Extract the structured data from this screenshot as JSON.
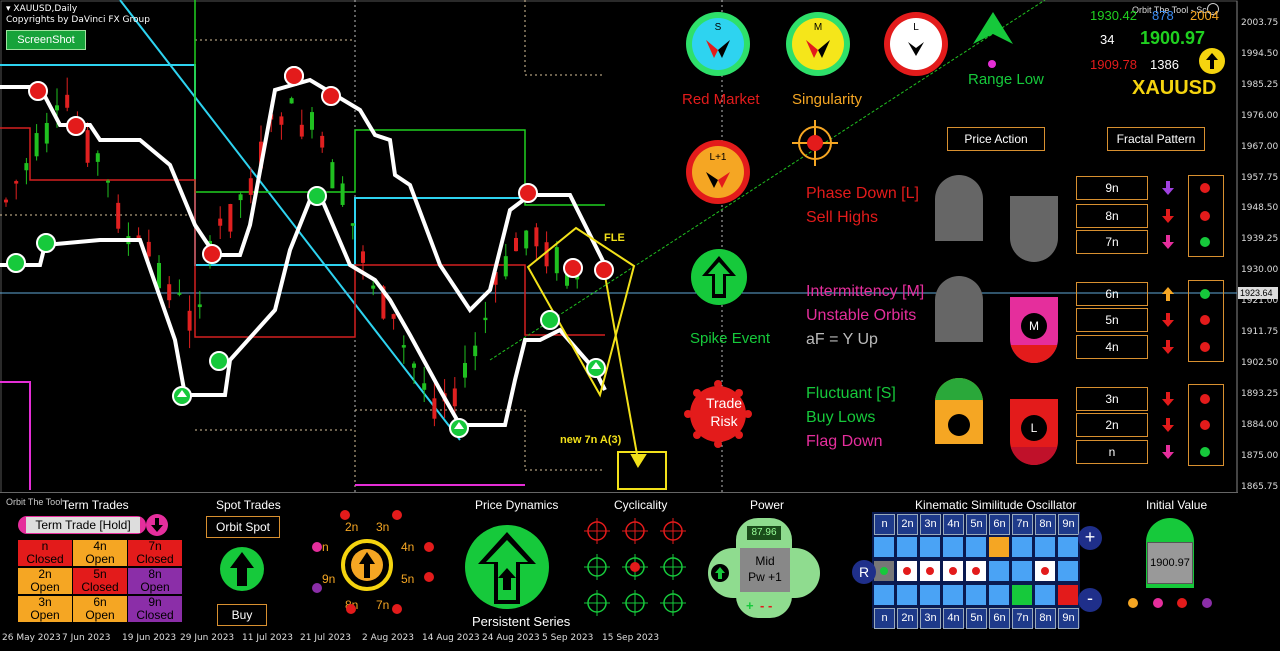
{
  "header": {
    "symbol_line": "XAUUSD,Daily",
    "copyright": "Copyrights by DaVinci FX Group",
    "screenshot_button": "ScreenShot",
    "tool_title": "Orbit The Tool - Sc..."
  },
  "price_axis": [
    "2003.75",
    "1994.50",
    "1985.25",
    "1976.00",
    "1967.00",
    "1957.75",
    "1948.50",
    "1939.25",
    "1930.00",
    "1921.00",
    "1911.75",
    "1902.50",
    "1893.25",
    "1884.00",
    "1875.00",
    "1865.75"
  ],
  "current_price": "1923.64",
  "dates": [
    "26 May 2023",
    "7 Jun 2023",
    "19 Jun 2023",
    "29 Jun 2023",
    "11 Jul 2023",
    "21 Jul 2023",
    "2 Aug 2023",
    "14 Aug 2023",
    "24 Aug 2023",
    "5 Sep 2023",
    "15 Sep 2023"
  ],
  "chart_annotations": {
    "fle": "FLE",
    "new_target": "new 7n A(3)"
  },
  "info_box": {
    "v1": "1930.42",
    "v2": "878",
    "v3": "2004",
    "v4": "34",
    "v5": "1900.97",
    "v6": "1909.78",
    "v7": "1386",
    "symbol": "XAUUSD"
  },
  "indicators": {
    "s_letter": "S",
    "m_letter": "M",
    "l_letter": "L",
    "l1_letter": "L+1",
    "range_low": "Range Low",
    "red_market": "Red Market",
    "singularity": "Singularity",
    "spike_event": "Spike Event",
    "trade_risk_1": "Trade",
    "trade_risk_2": "Risk"
  },
  "tabs": {
    "price_action": "Price Action",
    "fractal_pattern": "Fractal Pattern"
  },
  "phase": {
    "p1": "Phase Down [L]",
    "p2": "Sell Highs",
    "p3": "Intermittency [M]",
    "p4": "Unstable Orbits",
    "p5": "aF = Y Up",
    "p6": "Fluctuant [S]",
    "p7": "Buy Lows",
    "p8": "Flag Down",
    "m_badge": "M",
    "l_badge": "L"
  },
  "fractals": [
    "9n",
    "8n",
    "7n",
    "6n",
    "5n",
    "4n",
    "3n",
    "2n",
    "n"
  ],
  "bottom": {
    "label": "Orbit The Tool",
    "term_trades": "Term Trades",
    "term_trade_hold": "Term Trade [Hold]",
    "tt_cells": [
      {
        "a": "n",
        "b": "Closed"
      },
      {
        "a": "4n",
        "b": "Open"
      },
      {
        "a": "7n",
        "b": "Closed"
      },
      {
        "a": "2n",
        "b": "Open"
      },
      {
        "a": "5n",
        "b": "Closed"
      },
      {
        "a": "8n",
        "b": "Open"
      },
      {
        "a": "3n",
        "b": "Open"
      },
      {
        "a": "6n",
        "b": "Open"
      },
      {
        "a": "9n",
        "b": "Closed"
      }
    ],
    "spot_trades": "Spot Trades",
    "orbit_spot": "Orbit Spot",
    "buy": "Buy",
    "orbit_labels": [
      "2n",
      "3n",
      "4n",
      "5n",
      "7n",
      "8n",
      "9n",
      "n"
    ],
    "price_dynamics": "Price Dynamics",
    "persistent_series": "Persistent Series",
    "cyclicality": "Cyclicality",
    "power": "Power",
    "power_value": "87.96",
    "mid": "Mid",
    "pw": "Pw +1",
    "kso": "Kinematic Similitude Oscillator",
    "kso_cols": [
      "n",
      "2n",
      "3n",
      "4n",
      "5n",
      "6n",
      "7n",
      "8n",
      "9n"
    ],
    "plus": "+",
    "minus": "-",
    "r": "R",
    "initial_value": "Initial Value",
    "initial_price": "1900.97"
  },
  "colors": {
    "green": "#16c93b",
    "red": "#e31b1b",
    "magenta": "#e52e9c",
    "orange": "#f5a623",
    "cyan": "#2ed3f0",
    "gold": "#f5d40f",
    "blue": "#1f5fd6"
  }
}
